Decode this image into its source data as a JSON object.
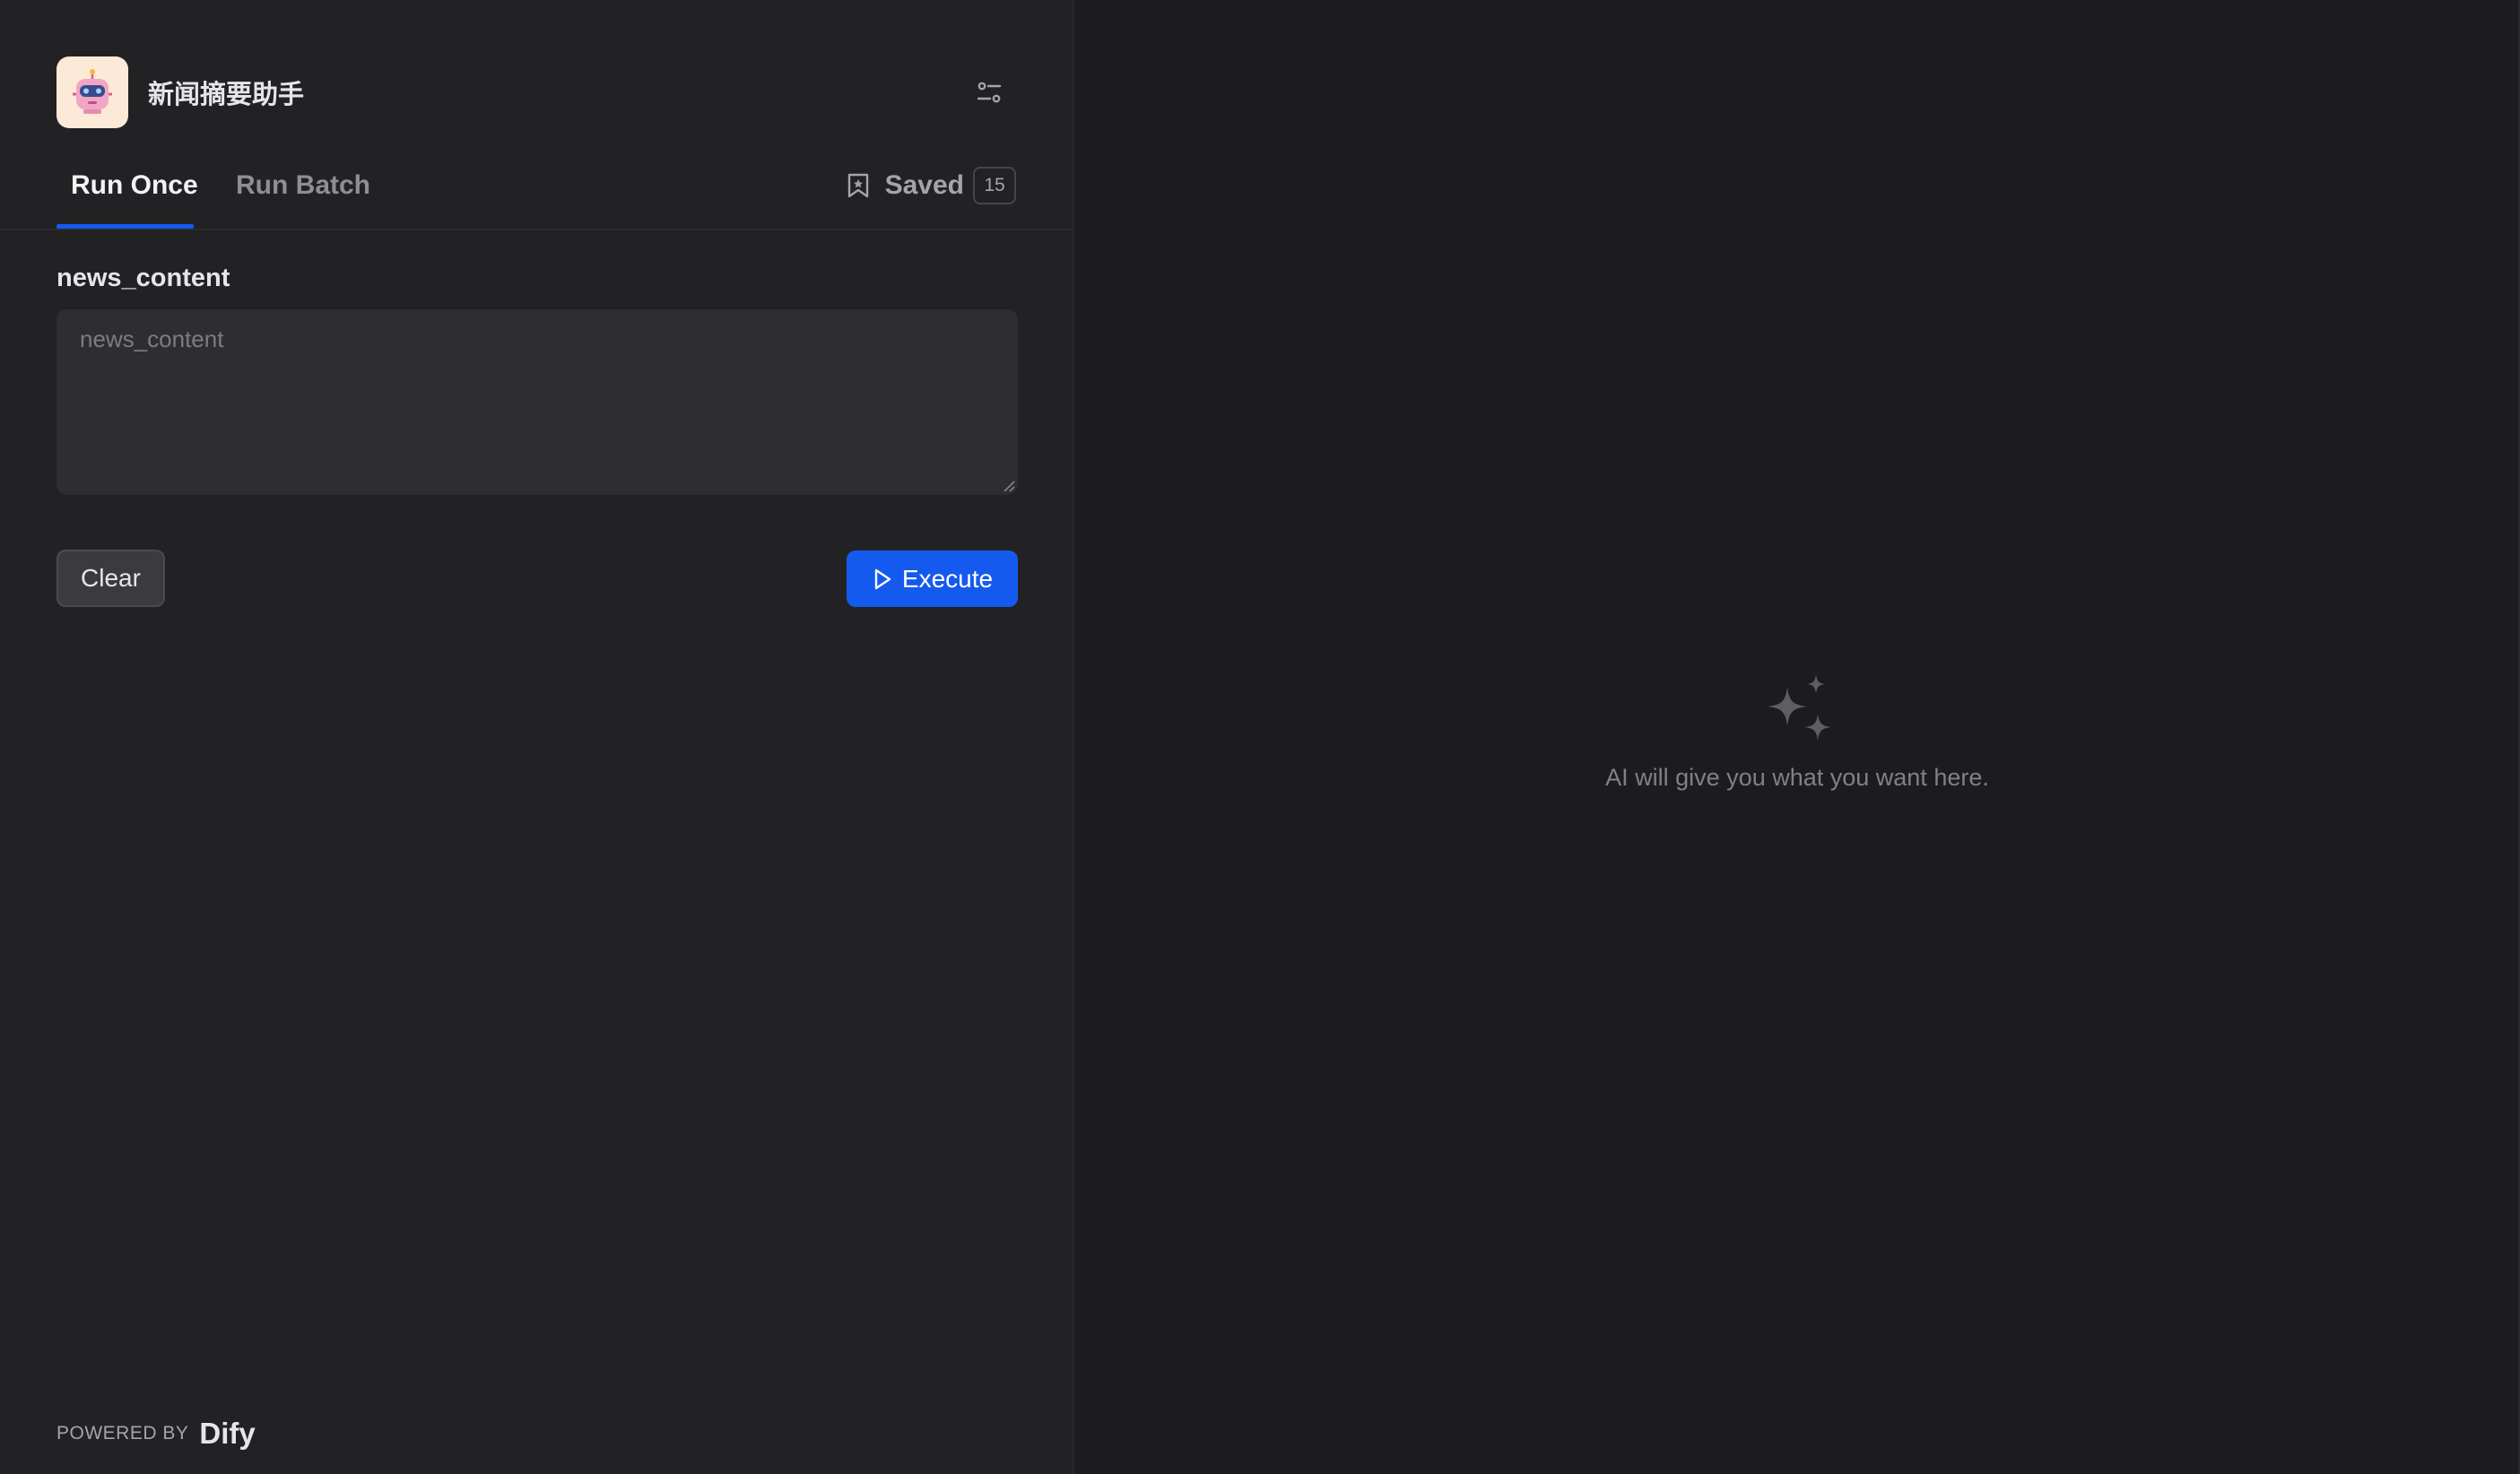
{
  "app": {
    "title": "新闻摘要助手",
    "icon": "robot-icon"
  },
  "tabs": {
    "run_once": "Run Once",
    "run_batch": "Run Batch",
    "active": "Run Once"
  },
  "saved": {
    "label": "Saved",
    "count": "15"
  },
  "form": {
    "field_label": "news_content",
    "field_placeholder": "news_content",
    "field_value": ""
  },
  "actions": {
    "clear_label": "Clear",
    "execute_label": "Execute"
  },
  "footer": {
    "powered_by": "POWERED BY",
    "brand": "Dify"
  },
  "result": {
    "empty_text": "AI will give you what you want here.",
    "icon": "sparkles-icon"
  },
  "colors": {
    "accent": "#155aef",
    "panel_bg": "#222225",
    "result_bg": "#1c1c1f",
    "input_bg": "#2e2e32"
  }
}
